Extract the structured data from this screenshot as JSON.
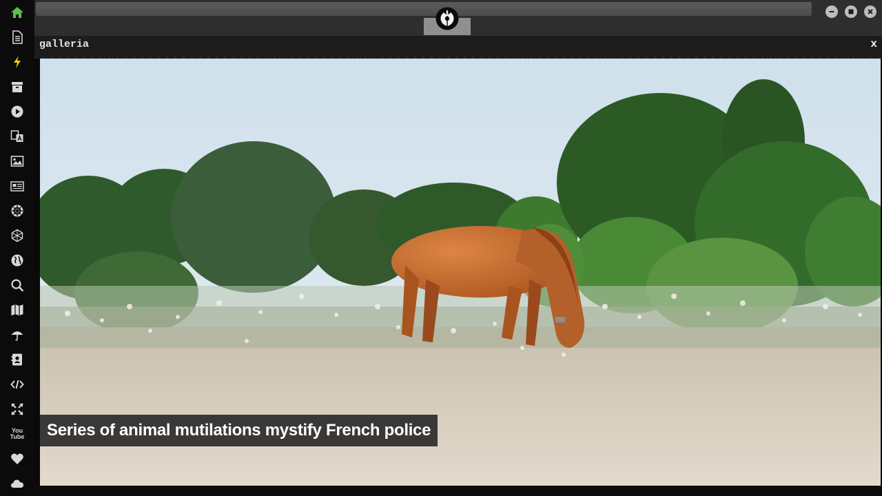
{
  "window": {
    "title": "galleria",
    "close_label": "x"
  },
  "gallery": {
    "caption": "Series of animal mutilations mystify French police"
  },
  "sidebar": {
    "items": [
      {
        "icon": "home-icon",
        "color": "#58c14a"
      },
      {
        "icon": "document-icon"
      },
      {
        "icon": "lightning-icon",
        "color": "#f5c518"
      },
      {
        "icon": "archive-icon"
      },
      {
        "icon": "play-icon"
      },
      {
        "icon": "translate-icon"
      },
      {
        "icon": "image-icon"
      },
      {
        "icon": "newspaper-icon"
      },
      {
        "icon": "rebel-badge-icon"
      },
      {
        "icon": "hexagon-network-icon"
      },
      {
        "icon": "globe-icon"
      },
      {
        "icon": "search-icon"
      },
      {
        "icon": "map-icon"
      },
      {
        "icon": "umbrella-icon"
      },
      {
        "icon": "contact-card-icon"
      },
      {
        "icon": "code-icon"
      },
      {
        "icon": "fullscreen-icon"
      },
      {
        "icon": "youtube-icon",
        "label_top": "You",
        "label_bottom": "Tube"
      },
      {
        "icon": "heart-icon"
      },
      {
        "icon": "cloud-icon"
      }
    ]
  },
  "topbar": {
    "logo": "rebel-alliance-icon",
    "window_buttons": [
      "minimize-icon",
      "maximize-icon",
      "close-icon"
    ]
  },
  "colors": {
    "sidebar_bg": "#0b0b0b",
    "topbar_bg": "#2e2e2e",
    "accent_home": "#58c14a",
    "accent_lightning": "#f5c518"
  }
}
